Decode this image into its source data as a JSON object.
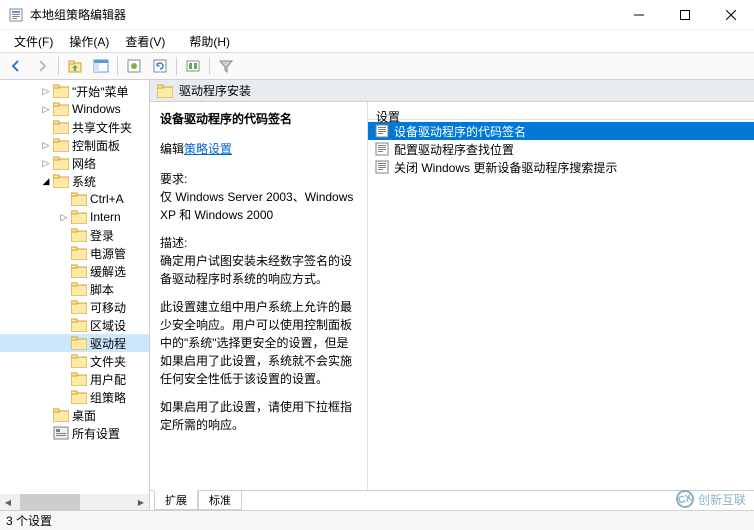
{
  "window": {
    "title": "本地组策略编辑器"
  },
  "menu": {
    "file": "文件(F)",
    "action": "操作(A)",
    "view": "查看(V)",
    "help": "帮助(H)"
  },
  "tree": [
    {
      "indent": 40,
      "exp": "▷",
      "label": "\"开始\"菜单"
    },
    {
      "indent": 40,
      "exp": "▷",
      "label": "Windows"
    },
    {
      "indent": 40,
      "exp": "",
      "label": "共享文件夹"
    },
    {
      "indent": 40,
      "exp": "▷",
      "label": "控制面板"
    },
    {
      "indent": 40,
      "exp": "▷",
      "label": "网络"
    },
    {
      "indent": 40,
      "exp": "◢",
      "label": "系统"
    },
    {
      "indent": 58,
      "exp": "",
      "label": "Ctrl+A"
    },
    {
      "indent": 58,
      "exp": "▷",
      "label": "Intern"
    },
    {
      "indent": 58,
      "exp": "",
      "label": "登录"
    },
    {
      "indent": 58,
      "exp": "",
      "label": "电源管"
    },
    {
      "indent": 58,
      "exp": "",
      "label": "缓解选"
    },
    {
      "indent": 58,
      "exp": "",
      "label": "脚本"
    },
    {
      "indent": 58,
      "exp": "",
      "label": "可移动"
    },
    {
      "indent": 58,
      "exp": "",
      "label": "区域设"
    },
    {
      "indent": 58,
      "exp": "",
      "label": "驱动程",
      "selected": true
    },
    {
      "indent": 58,
      "exp": "",
      "label": "文件夹"
    },
    {
      "indent": 58,
      "exp": "",
      "label": "用户配"
    },
    {
      "indent": 58,
      "exp": "",
      "label": "组策略"
    },
    {
      "indent": 40,
      "exp": "",
      "label": "桌面"
    },
    {
      "indent": 40,
      "exp": "",
      "label": "所有设置"
    }
  ],
  "main": {
    "header": "驱动程序安装",
    "desc_title": "设备驱动程序的代码签名",
    "edit_label": "编辑",
    "policy_link": "策略设置",
    "req_label": "要求:",
    "req_text": "仅 Windows Server 2003、Windows XP 和 Windows 2000",
    "desc_label": "描述:",
    "desc_text1": "确定用户试图安装未经数字签名的设备驱动程序时系统的响应方式。",
    "desc_text2": "此设置建立组中用户系统上允许的最少安全响应。用户可以使用控制面板中的\"系统\"选择更安全的设置，但是如果启用了此设置，系统就不会实施任何安全性低于该设置的设置。",
    "desc_text3": "如果启用了此设置，请使用下拉框指定所需的响应。",
    "list_header": "设置",
    "list": [
      {
        "label": "设备驱动程序的代码签名",
        "selected": true
      },
      {
        "label": "配置驱动程序查找位置"
      },
      {
        "label": "关闭 Windows 更新设备驱动程序搜索提示"
      }
    ]
  },
  "tabs": {
    "extended": "扩展",
    "standard": "标准"
  },
  "status": "3 个设置",
  "watermark": "创新互联"
}
